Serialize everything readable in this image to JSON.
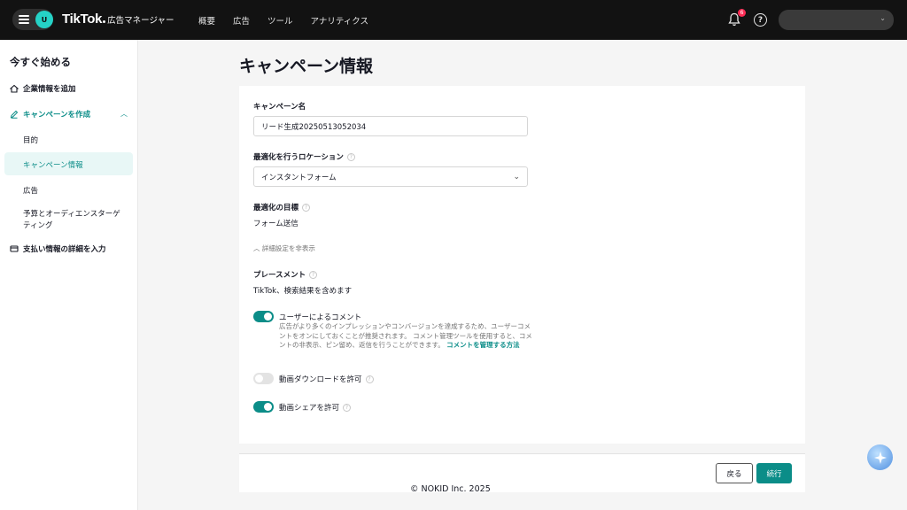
{
  "header": {
    "avatar_initial": "U",
    "brand": "TikTok",
    "brand_sub": "広告マネージャー",
    "nav": [
      "概要",
      "広告",
      "ツール",
      "アナリティクス"
    ],
    "notification_count": "6",
    "help": "?"
  },
  "sidebar": {
    "title": "今すぐ始める",
    "items": [
      {
        "label": "企業情報を追加",
        "icon": "home-icon"
      },
      {
        "label": "キャンペーンを作成",
        "icon": "pencil-icon"
      },
      {
        "label": "目的"
      },
      {
        "label": "キャンペーン情報"
      },
      {
        "label": "広告"
      },
      {
        "label": "予算とオーディエンスターゲ"
      },
      {
        "label": "ティング"
      },
      {
        "label": "支払い情報の詳細を入力",
        "icon": "card-icon"
      }
    ]
  },
  "main": {
    "page_title": "キャンペーン情報",
    "campaign_name_label": "キャンペーン名",
    "campaign_name_value": "リード生成20250513052034",
    "location_label": "最適化を行うロケーション",
    "location_value": "インスタントフォーム",
    "goal_label": "最適化の目標",
    "goal_value": "フォーム送信",
    "advanced_toggle": "詳細設定を非表示",
    "placement_label": "プレースメント",
    "placement_value": "TikTok、検索結果を含めます",
    "comments_label": "ユーザーによるコメント",
    "comments_desc": "広告がより多くのインプレッションやコンバージョンを達成するため、ユーザーコメントをオンにしておくことが推奨されます。 コメント管理ツールを使用すると、コメントの非表示、ピン留め、返信を行うことができます。",
    "comments_link": "コメントを管理する方法",
    "download_label": "動画ダウンロードを許可",
    "share_label": "動画シェアを許可",
    "toggles": {
      "comments": true,
      "download": false,
      "share": true
    }
  },
  "footer": {
    "back": "戻る",
    "next": "続行",
    "copyright": "© NOKID Inc. 2025"
  },
  "colors": {
    "accent": "#0b8d88",
    "topbar": "#121212"
  }
}
